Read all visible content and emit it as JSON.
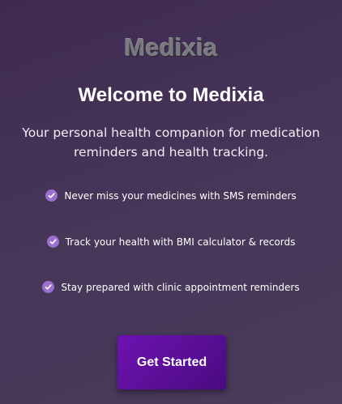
{
  "app": {
    "logo_text": "Medixia"
  },
  "welcome": {
    "title": "Welcome to Medixia",
    "subtitle": "Your personal health companion for medication reminders and health tracking."
  },
  "features": [
    {
      "icon": "check-circle-icon",
      "text": "Never miss your medicines with SMS reminders"
    },
    {
      "icon": "check-circle-icon",
      "text": "Track your health with BMI calculator & records"
    },
    {
      "icon": "check-circle-icon",
      "text": "Stay prepared with clinic appointment reminders"
    }
  ],
  "cta": {
    "label": "Get Started"
  },
  "colors": {
    "background": "#463558",
    "accent": "#6d12b0",
    "check": "#9b6fd0"
  }
}
